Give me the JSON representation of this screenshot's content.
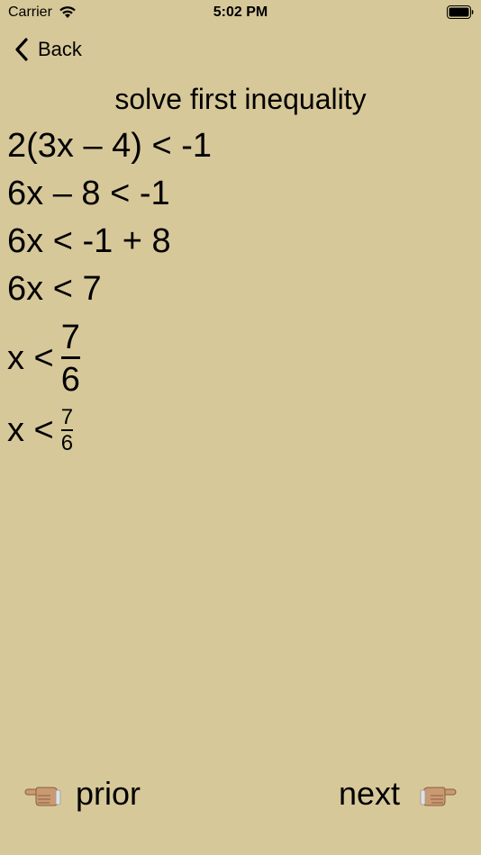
{
  "status_bar": {
    "carrier": "Carrier",
    "time": "5:02 PM"
  },
  "nav": {
    "back_label": "Back"
  },
  "title": "solve first inequality",
  "steps": [
    "2(3x – 4) < -1",
    "6x – 8 < -1",
    "6x < -1 + 8",
    "6x < 7"
  ],
  "fraction_steps": [
    {
      "lhs": "x <",
      "numerator": "7",
      "denominator": "6"
    },
    {
      "lhs": "x <",
      "numerator": "7",
      "denominator": "6"
    }
  ],
  "buttons": {
    "prior_label": "prior",
    "next_label": "next"
  },
  "icons": {
    "back": "chevron-left-icon",
    "wifi": "wifi-icon",
    "battery": "battery-icon",
    "prior": "pointing-left-hand-icon",
    "next": "pointing-right-hand-icon"
  },
  "colors": {
    "background": "#d7c899",
    "text": "#000000",
    "hand_skin": "#c99a72"
  }
}
